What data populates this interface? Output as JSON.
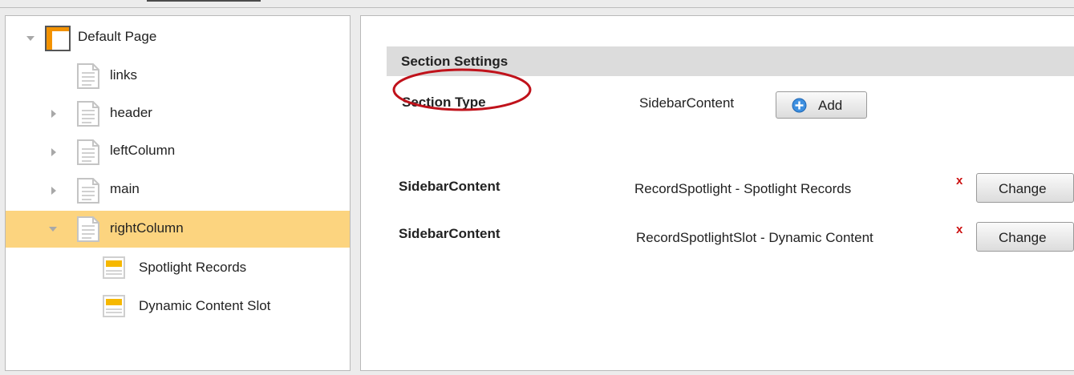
{
  "tree": {
    "nodes": [
      {
        "label": "Default Page",
        "icon": "page-layout-icon",
        "expander": "expanded"
      },
      {
        "label": "links",
        "icon": "document-icon",
        "expander": "none"
      },
      {
        "label": "header",
        "icon": "document-icon",
        "expander": "collapsed"
      },
      {
        "label": "leftColumn",
        "icon": "document-icon",
        "expander": "collapsed"
      },
      {
        "label": "main",
        "icon": "document-icon",
        "expander": "collapsed"
      },
      {
        "label": "rightColumn",
        "icon": "document-icon",
        "expander": "expanded",
        "selected": true
      },
      {
        "label": "Spotlight Records",
        "icon": "content-block-icon",
        "expander": "none"
      },
      {
        "label": "Dynamic Content Slot",
        "icon": "content-block-icon",
        "expander": "none"
      }
    ]
  },
  "settings": {
    "header": "Section Settings",
    "section_type": {
      "label": "Section Type",
      "value": "SidebarContent",
      "add_label": "Add"
    },
    "rows": [
      {
        "type": "SidebarContent",
        "content": "RecordSpotlight - Spotlight Records",
        "remove": "x",
        "change_label": "Change"
      },
      {
        "type": "SidebarContent",
        "content": "RecordSpotlightSlot - Dynamic Content",
        "remove": "x",
        "change_label": "Change"
      }
    ]
  },
  "colors": {
    "selected_row": "#fcd47f",
    "highlight_circle": "#c0121b",
    "remove_x": "#cc1111",
    "header_bg": "#dcdcdc"
  }
}
